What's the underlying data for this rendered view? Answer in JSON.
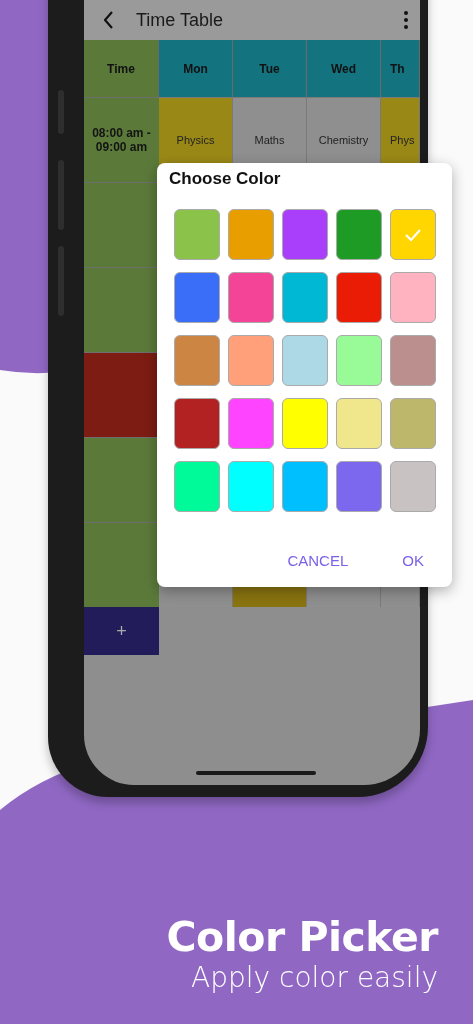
{
  "toolbar": {
    "title": "Time Table"
  },
  "timetable": {
    "time_header": "Time",
    "days": [
      {
        "label": "Mon"
      },
      {
        "label": "Tue"
      },
      {
        "label": "Wed"
      },
      {
        "label": "Th"
      }
    ],
    "rows": [
      {
        "time": "08:00 am - 09:00 am",
        "color": "#5b7a3a",
        "cells": [
          {
            "text": "Physics",
            "color": "#9a8816"
          },
          {
            "text": "Maths",
            "color": "#8f8f8f"
          },
          {
            "text": "Chemistry",
            "color": "#8f8f8f"
          },
          {
            "text": "Phys",
            "color": "#9a8816"
          }
        ]
      },
      {
        "color": "#5b7a3a"
      },
      {
        "color": "#5b7a3a"
      },
      {
        "color": "#7c1c12"
      },
      {
        "color": "#5b7a3a"
      },
      {
        "color": "#5b7a3a",
        "cells": [
          {
            "color": "#8f8f8f"
          },
          {
            "color": "#8a7410"
          },
          {
            "color": "#8f8f8f"
          },
          {
            "color": "#8f8f8f"
          }
        ]
      }
    ],
    "add_button": "+"
  },
  "dialog": {
    "title": "Choose Color",
    "swatches": [
      {
        "color": "#8bc34a",
        "selected": false
      },
      {
        "color": "#e99e00",
        "selected": false
      },
      {
        "color": "#a93ffa",
        "selected": false
      },
      {
        "color": "#1e9b24",
        "selected": false
      },
      {
        "color": "#ffd600",
        "selected": true
      },
      {
        "color": "#3b6ef8",
        "selected": false
      },
      {
        "color": "#f44497",
        "selected": false
      },
      {
        "color": "#00b7d4",
        "selected": false
      },
      {
        "color": "#eb1c06",
        "selected": false
      },
      {
        "color": "#ffb3c1",
        "selected": false
      },
      {
        "color": "#cd8543",
        "selected": false
      },
      {
        "color": "#ffa07a",
        "selected": false
      },
      {
        "color": "#add8e6",
        "selected": false
      },
      {
        "color": "#98fb98",
        "selected": false
      },
      {
        "color": "#bc8f8f",
        "selected": false
      },
      {
        "color": "#b22222",
        "selected": false
      },
      {
        "color": "#ff44ff",
        "selected": false
      },
      {
        "color": "#ffff00",
        "selected": false
      },
      {
        "color": "#f0e68c",
        "selected": false
      },
      {
        "color": "#bdb76b",
        "selected": false
      },
      {
        "color": "#00fa9a",
        "selected": false
      },
      {
        "color": "#00ffff",
        "selected": false
      },
      {
        "color": "#00bfff",
        "selected": false
      },
      {
        "color": "#7b68ee",
        "selected": false
      },
      {
        "color": "#c8c2c2",
        "selected": false
      }
    ],
    "buttons": [
      "CANCEL",
      "OK"
    ]
  },
  "caption": {
    "title": "Color Picker",
    "subtitle": "Apply color easily"
  }
}
